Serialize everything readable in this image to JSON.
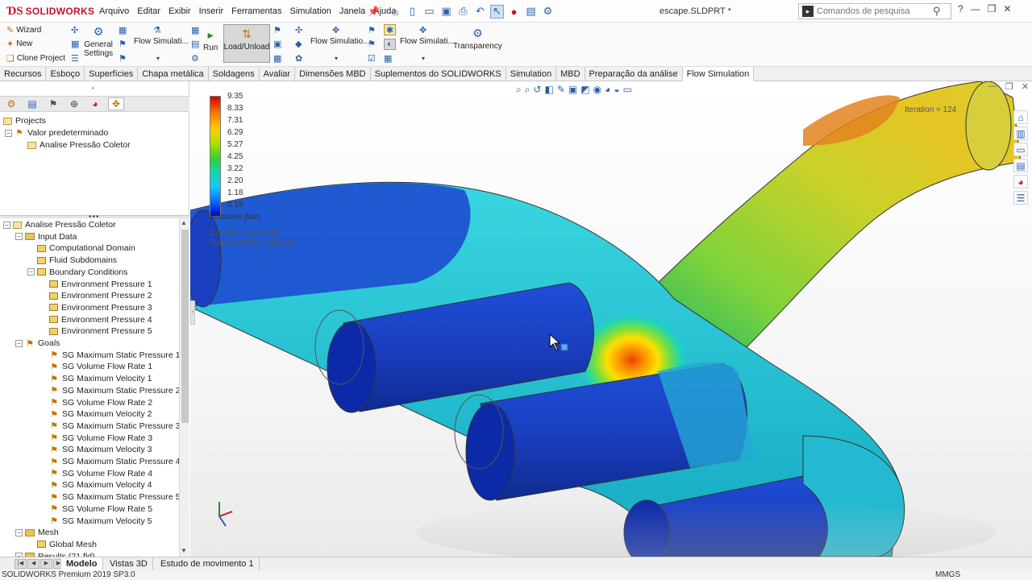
{
  "app": {
    "logo_text": "SOLIDWORKS",
    "doc_title": "escape.SLDPRT *"
  },
  "menu": [
    "Arquivo",
    "Editar",
    "Exibir",
    "Inserir",
    "Ferramentas",
    "Simulation",
    "Janela",
    "Ajuda"
  ],
  "search": {
    "placeholder": "Comandos de pesquisa"
  },
  "commands": {
    "wizard": "Wizard",
    "new": "New",
    "clone_project": "Clone Project",
    "general_settings_1": "General",
    "general_settings_2": "Settings",
    "flow_sim_1": "Flow Simulati...",
    "run": "Run",
    "load_unload": "Load/Unload",
    "flow_sim_2": "Flow Simulatio...",
    "flow_sim_3": "Flow Simulati...",
    "transparency": "Transparency"
  },
  "tabs": [
    {
      "label": "Recursos",
      "active": false
    },
    {
      "label": "Esboço",
      "active": false
    },
    {
      "label": "Superfícies",
      "active": false
    },
    {
      "label": "Chapa metálica",
      "active": false
    },
    {
      "label": "Soldagens",
      "active": false
    },
    {
      "label": "Avaliar",
      "active": false
    },
    {
      "label": "Dimensões MBD",
      "active": false
    },
    {
      "label": "Suplementos do SOLIDWORKS",
      "active": false
    },
    {
      "label": "Simulation",
      "active": false
    },
    {
      "label": "MBD",
      "active": false
    },
    {
      "label": "Preparação da análise",
      "active": false
    },
    {
      "label": "Flow Simulation",
      "active": true
    }
  ],
  "projects_tree": {
    "root": "Projects",
    "config": "Valor predeterminado",
    "project": "Analise Pressão Coletor"
  },
  "analysis_tree": {
    "root": "Analise Pressão Coletor",
    "input_data": "Input Data",
    "computational_domain": "Computational Domain",
    "fluid_subdomains": "Fluid Subdomains",
    "boundary_conditions": "Boundary Conditions",
    "bc_items": [
      "Environment Pressure 1",
      "Environment Pressure 2",
      "Environment Pressure 3",
      "Environment Pressure 4",
      "Environment Pressure 5"
    ],
    "goals": "Goals",
    "goal_items": [
      "SG Maximum Static Pressure 1",
      "SG Volume Flow Rate 1",
      "SG Maximum Velocity 1",
      "SG Maximum Static Pressure 2",
      "SG Volume Flow Rate 2",
      "SG Maximum Velocity 2",
      "SG Maximum Static Pressure 3",
      "SG Volume Flow Rate 3",
      "SG Maximum Velocity 3",
      "SG Maximum Static Pressure 4",
      "SG Volume Flow Rate 4",
      "SG Maximum Velocity 4",
      "SG Maximum Static Pressure 5",
      "SG Volume Flow Rate 5",
      "SG Maximum Velocity 5"
    ],
    "mesh": "Mesh",
    "global_mesh": "Global Mesh",
    "results": "Results (21 fld)"
  },
  "legend": {
    "values": [
      "9.35",
      "8.33",
      "7.31",
      "6.29",
      "5.27",
      "4.25",
      "3.22",
      "2.20",
      "1.18",
      "0.16"
    ],
    "title": "Pressure [bar]",
    "cut_plot": "Cut Plot 1: contours",
    "surface_plot": "Surface Plot 1: contours",
    "iteration": "Iteration = 124"
  },
  "bottom_tabs": [
    {
      "label": "Modelo",
      "active": true
    },
    {
      "label": "Vistas 3D",
      "active": false
    },
    {
      "label": "Estudo de movimento 1",
      "active": false
    }
  ],
  "status": {
    "text": "SOLIDWORKS Premium 2019 SP3.0",
    "units": "MMGS"
  }
}
